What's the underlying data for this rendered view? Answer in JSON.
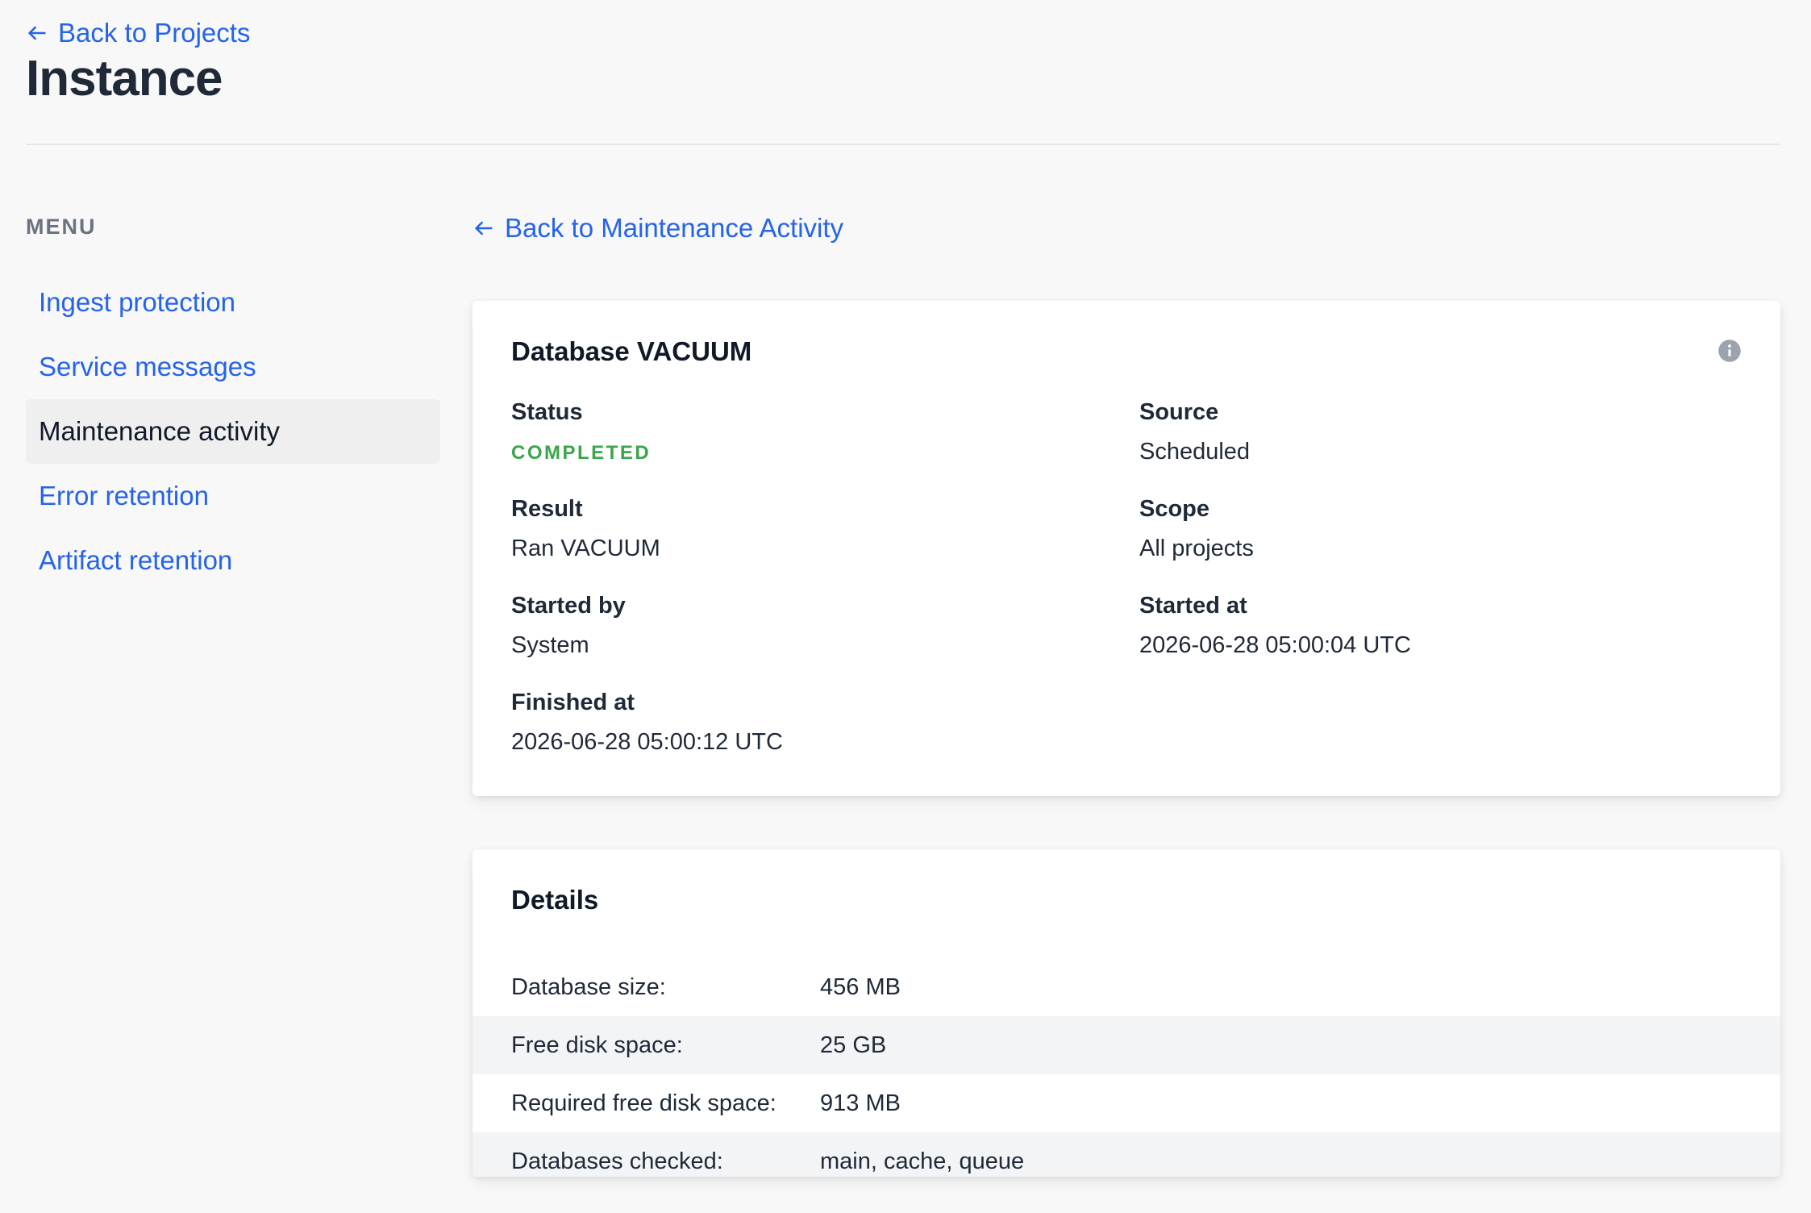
{
  "header": {
    "back_link": "Back to Projects",
    "title": "Instance"
  },
  "sidebar": {
    "heading": "MENU",
    "items": [
      {
        "label": "Ingest protection",
        "active": false
      },
      {
        "label": "Service messages",
        "active": false
      },
      {
        "label": "Maintenance activity",
        "active": true
      },
      {
        "label": "Error retention",
        "active": false
      },
      {
        "label": "Artifact retention",
        "active": false
      }
    ]
  },
  "main": {
    "back_link": "Back to Maintenance Activity",
    "summary": {
      "title": "Database VACUUM",
      "fields": {
        "status": {
          "label": "Status",
          "value": "COMPLETED"
        },
        "source": {
          "label": "Source",
          "value": "Scheduled"
        },
        "result": {
          "label": "Result",
          "value": "Ran VACUUM"
        },
        "scope": {
          "label": "Scope",
          "value": "All projects"
        },
        "started_by": {
          "label": "Started by",
          "value": "System"
        },
        "started_at": {
          "label": "Started at",
          "value": "2026-06-28 05:00:04 UTC"
        },
        "finished_at": {
          "label": "Finished at",
          "value": "2026-06-28 05:00:12 UTC"
        }
      }
    },
    "details": {
      "title": "Details",
      "rows": [
        {
          "key": "Database size:",
          "value": "456 MB"
        },
        {
          "key": "Free disk space:",
          "value": "25 GB"
        },
        {
          "key": "Required free disk space:",
          "value": "913 MB"
        },
        {
          "key": "Databases checked:",
          "value": "main, cache, queue"
        }
      ]
    }
  },
  "colors": {
    "link": "#2563eb",
    "status_completed": "#3aa54b",
    "active_item_bg": "#efefef"
  },
  "icons": {
    "back": "arrow-left-icon",
    "info": "info-icon"
  }
}
